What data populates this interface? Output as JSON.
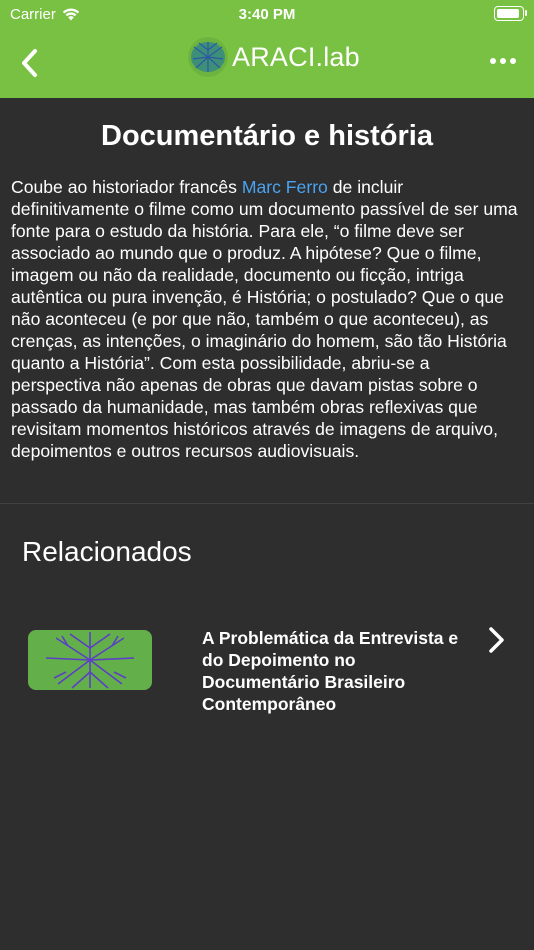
{
  "status_bar": {
    "carrier": "Carrier",
    "time": "3:40 PM"
  },
  "nav": {
    "brand": "ARACI.lab"
  },
  "article": {
    "title": "Documentário e história",
    "text_before_link": "Coube ao historiador francês ",
    "link_text": "Marc Ferro",
    "text_after_link": " de incluir definitivamente o filme como um documento passível de ser uma fonte para o estudo da história. Para ele, “o filme deve ser associado ao mundo que o produz. A hipótese? Que o filme, imagem ou não da realidade, documento ou ficção, intriga autêntica ou pura invenção, é História; o postulado? Que o que não aconteceu (e por que não, também o que aconteceu), as crenças, as intenções, o imaginário do homem, são tão História quanto a História”. Com esta possibilidade, abriu-se a perspectiva não apenas de obras que davam pistas sobre o passado da humanidade, mas também obras reflexivas que revisitam momentos históricos através de imagens de arquivo, depoimentos e outros recursos audiovisuais."
  },
  "related": {
    "heading": "Relacionados",
    "items": [
      {
        "title": "A Problemática da Entrevista e do Depoimento no Documentário Brasileiro Contemporâneo"
      }
    ]
  },
  "colors": {
    "nav_bg": "#79c142",
    "page_bg": "#2e2e2e",
    "link": "#4aa3f0"
  }
}
